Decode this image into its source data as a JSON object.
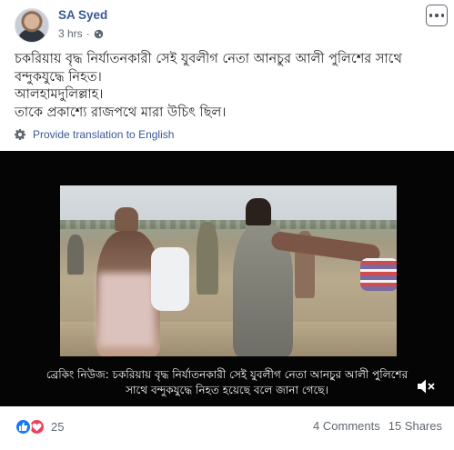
{
  "post": {
    "author": "SA Syed",
    "time": "3 hrs",
    "separator": "·",
    "audience_icon": "globe-icon",
    "more_icon": "ellipsis-icon",
    "text_lines": [
      "চকরিয়ায় বৃদ্ধ নির্যাতনকারী সেই যুবলীগ নেতা আনচুর আলী পুলিশের সাথে",
      "বন্দুকযুদ্ধে নিহত।",
      "আলহামদুলিল্লাহ।",
      "তাকে প্রকাশ্যে রাজপথে মারা উচিৎ ছিল।"
    ],
    "translate_label": "Provide translation to English"
  },
  "video": {
    "caption_lines": [
      "ব্রেকিং নিউজ: চকরিয়ায় বৃদ্ধ নির্যাতনকারী সেই যুবলীগ নেতা আনচুর আলী পুলিশের",
      "সাথে বন্দুকযুদ্ধে নিহত হয়েছে বলে জানা গেছে।"
    ],
    "mute_icon": "speaker-muted-icon"
  },
  "footer": {
    "reaction_icons": [
      "like-icon",
      "love-icon"
    ],
    "reaction_count": "25",
    "comments": "4 Comments",
    "shares": "15 Shares"
  },
  "colors": {
    "link": "#385898",
    "like": "#1877f2",
    "love": "#f33e58",
    "muted_text": "#606770"
  }
}
